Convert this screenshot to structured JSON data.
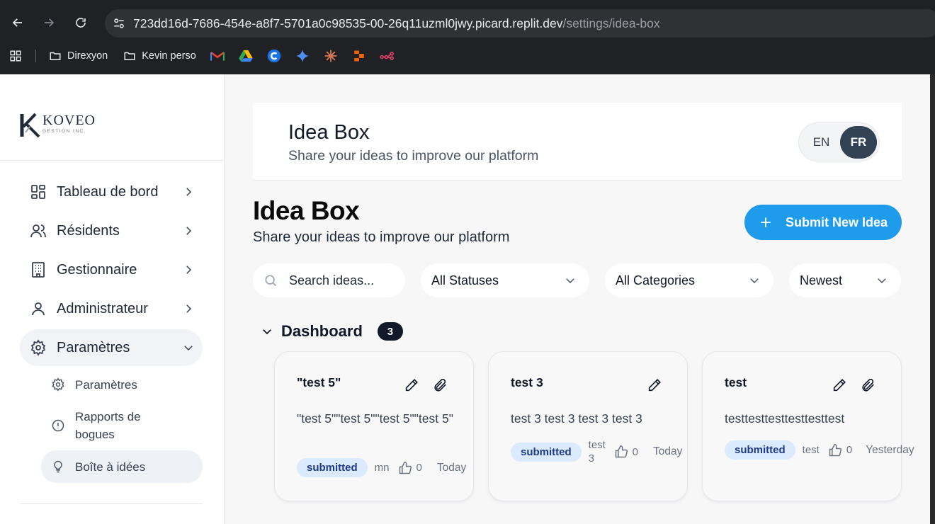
{
  "browser": {
    "url_main": "723dd16d-7686-454e-a8f7-5701a0c98535-00-26q11uzml0jwy.picard.replit.dev",
    "url_path": "/settings/idea-box",
    "bookmarks": [
      {
        "label": "Direxyon"
      },
      {
        "label": "Kevin perso"
      }
    ]
  },
  "sidebar": {
    "logo_text": "KOVEO",
    "logo_sub": "GESTION INC.",
    "items": [
      {
        "label": "Tableau de bord"
      },
      {
        "label": "Résidents"
      },
      {
        "label": "Gestionnaire"
      },
      {
        "label": "Administrateur"
      },
      {
        "label": "Paramètres"
      }
    ],
    "sub_items": [
      {
        "label": "Paramètres"
      },
      {
        "label": "Rapports de bogues"
      },
      {
        "label": "Boîte à idées"
      }
    ]
  },
  "header": {
    "title": "Idea Box",
    "subtitle": "Share your ideas to improve our platform",
    "lang_en": "EN",
    "lang_fr": "FR"
  },
  "main": {
    "title": "Idea Box",
    "subtitle": "Share your ideas to improve our platform",
    "submit_label": "Submit New Idea"
  },
  "filters": {
    "search_placeholder": "Search ideas...",
    "status": "All Statuses",
    "category": "All Categories",
    "sort": "Newest"
  },
  "group": {
    "name": "Dashboard",
    "count": "3"
  },
  "cards": [
    {
      "title": "\"test 5\"",
      "description": "\"test 5\"\"test 5\"\"test 5\"\"test 5\"",
      "status": "submitted",
      "author": "mn",
      "likes": "0",
      "date": "Today"
    },
    {
      "title": "test 3",
      "description": "test 3 test 3 test 3 test 3",
      "status": "submitted",
      "author": "test 3",
      "likes": "0",
      "date": "Today"
    },
    {
      "title": "test",
      "description": "testtesttesttesttesttest",
      "status": "submitted",
      "author": "test",
      "likes": "0",
      "date": "Yesterday"
    }
  ],
  "colors": {
    "accent": "#1e9bea",
    "badge_bg": "#dbeafe",
    "lang_active": "#334155"
  }
}
